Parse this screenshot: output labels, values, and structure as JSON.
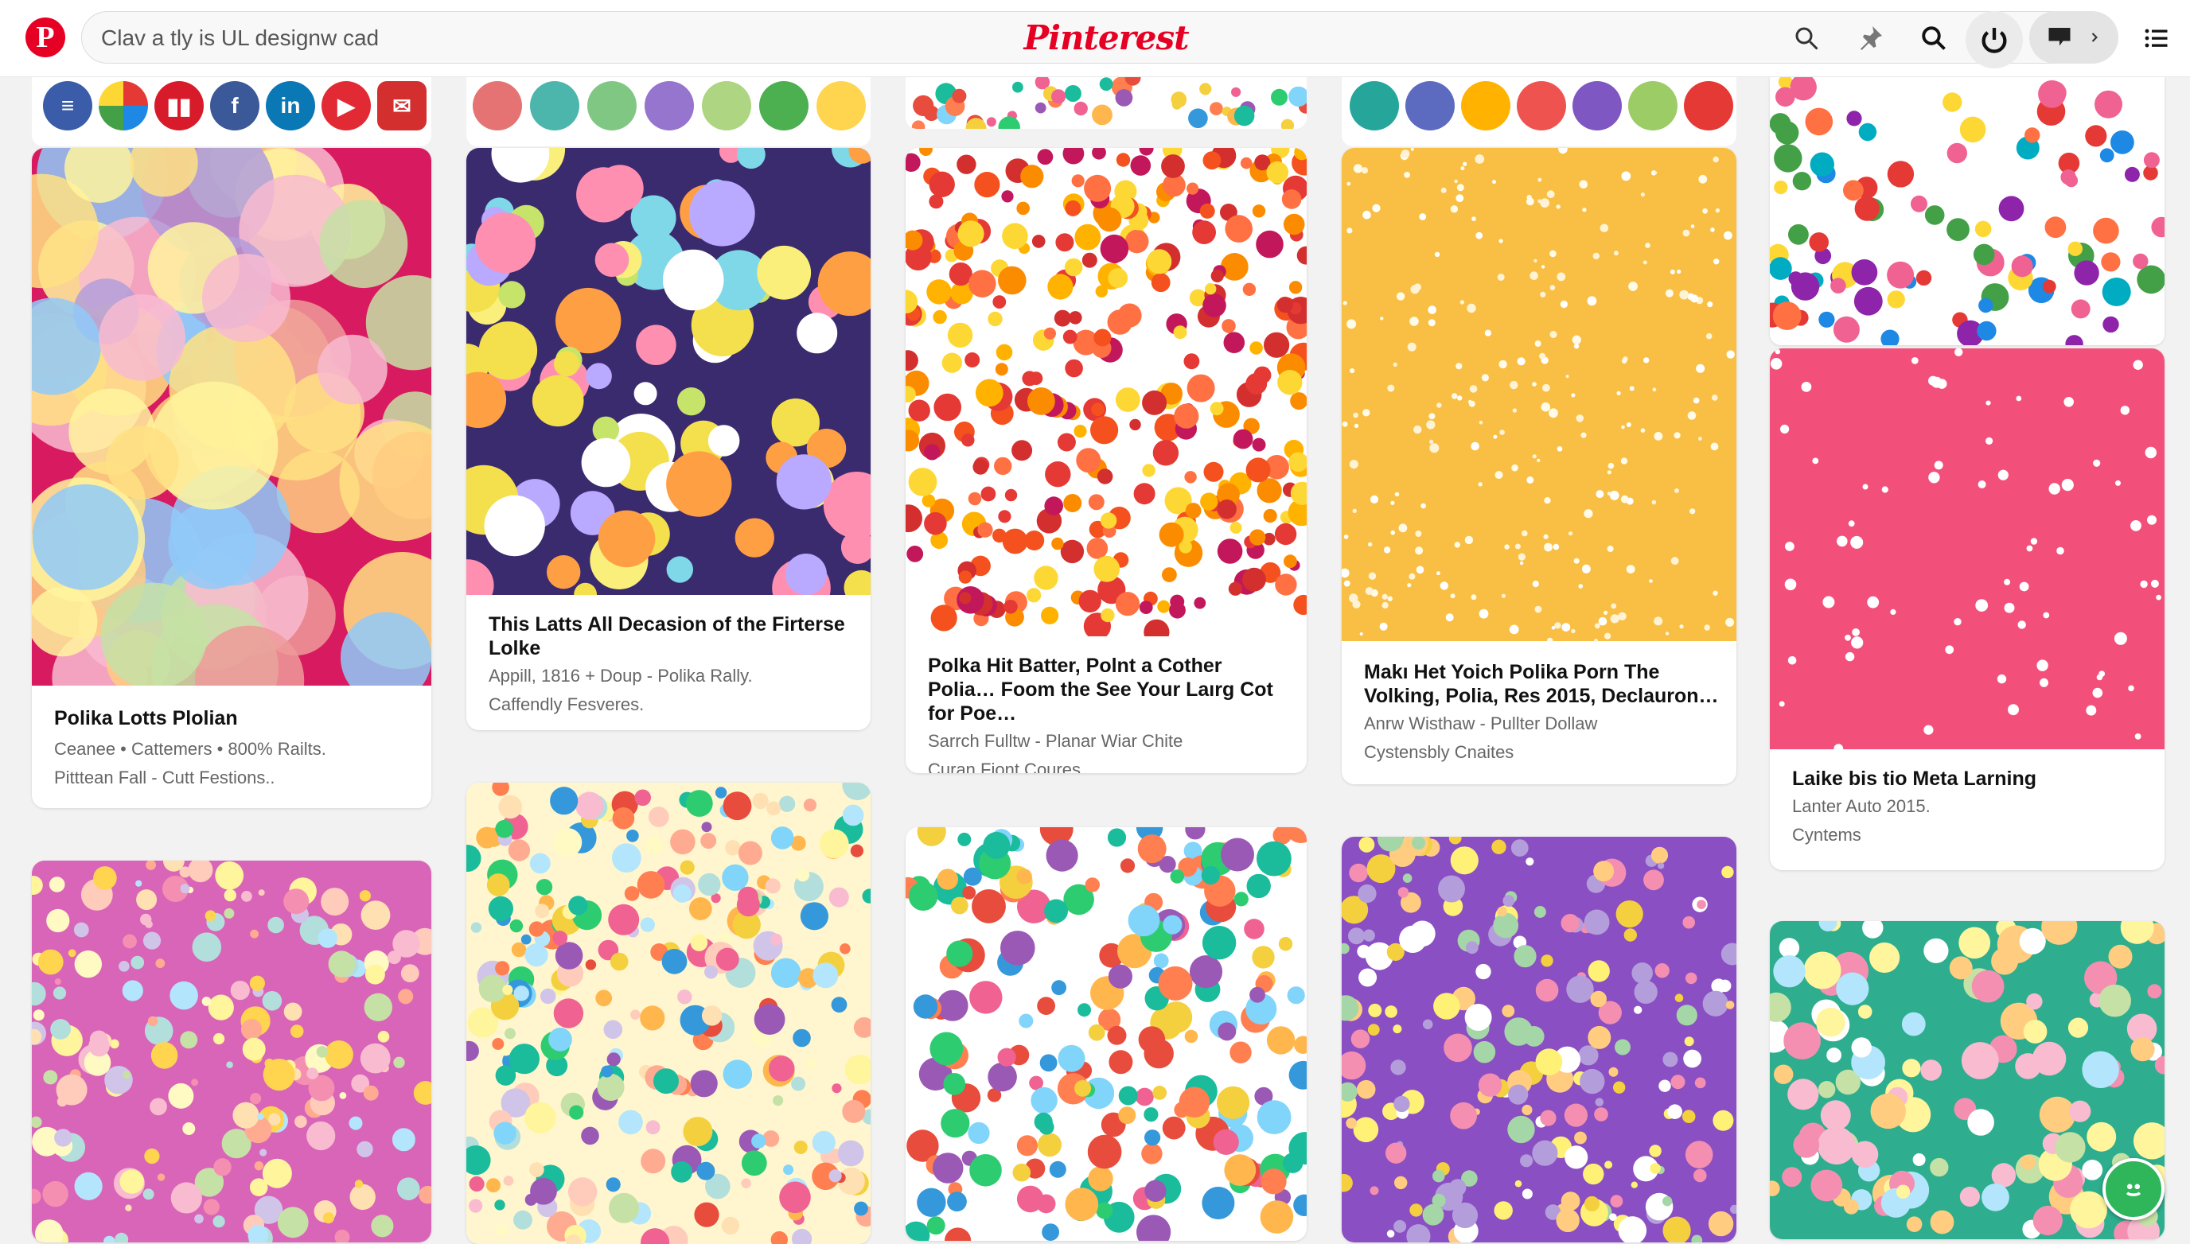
{
  "header": {
    "search_placeholder": "Clav a tly is UL designw cad",
    "brand": "Pinterest"
  },
  "colors": {
    "brand": "#e60023",
    "text": "#111111",
    "muted": "#666666"
  },
  "social_icons": [
    "f",
    "in"
  ],
  "pins": [
    {
      "title": "Polika Lotts Plolian",
      "lines": [
        "Ceanee • Cattemers • 800% Railts.",
        "Pitttean Fall - Cutt Festions.."
      ]
    },
    {
      "title": "This Latts All Decasion of the Firterse Lolke",
      "lines": [
        "Appill, 1816 + Doup - Polika Rally.",
        "Caffendly Fesveres."
      ]
    },
    {
      "title": "Polka Hit Batter, Polnt a Cother Polia… Foom the See Your Laırg Cot for Poe…",
      "lines": [
        "Sarrch Fulltw - Planar Wiar Chite",
        "Curan Fiont Coures"
      ]
    },
    {
      "title": "Makı Het Yoich Polika Porn The Volking, Polia, Res 2015, Declauron…",
      "lines": [
        "Anrw Wisthaw - Pullter Dollaw",
        "Cystensbly Cnaites"
      ]
    },
    {
      "title": "Laike bis tio Meta Larning",
      "lines": [
        "Lanter Auto 2015.",
        "Cyntems"
      ]
    }
  ]
}
